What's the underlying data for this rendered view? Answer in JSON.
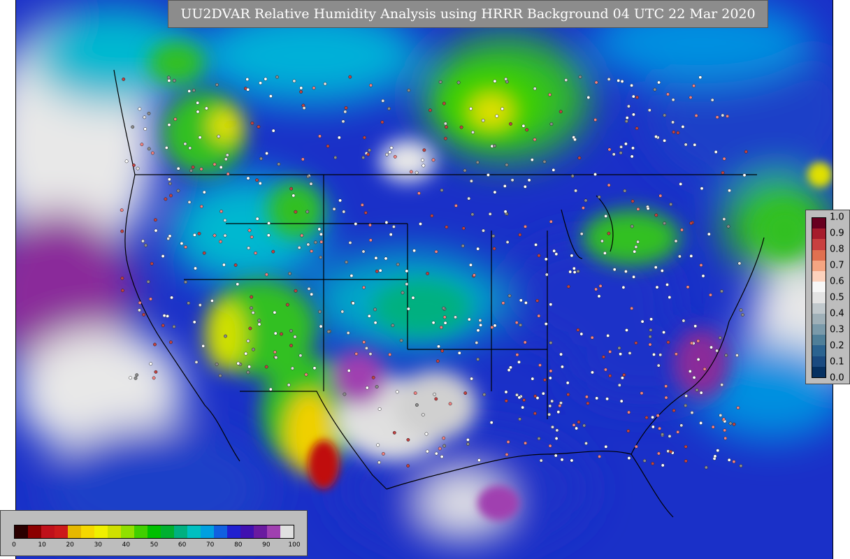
{
  "title": "UU2DVAR Relative Humidity Analysis using HRRR Background 04 UTC 22 Mar 2020",
  "map": {
    "region": "Continental United States",
    "field": "Relative Humidity",
    "overlays": [
      "coastlines",
      "state-borders",
      "country-borders",
      "observation-station-markers"
    ]
  },
  "rh_colorbar": {
    "ticks": [
      "0",
      "10",
      "20",
      "30",
      "40",
      "50",
      "60",
      "70",
      "80",
      "90",
      "100"
    ],
    "colors": [
      "#2a0000",
      "#8b0000",
      "#c0101a",
      "#cc1a1a",
      "#e6b800",
      "#f5d800",
      "#f0f000",
      "#cfe000",
      "#90e000",
      "#40d000",
      "#00c000",
      "#00b030",
      "#00b080",
      "#00c0c0",
      "#00a0e0",
      "#1060e0",
      "#2020d0",
      "#4010b0",
      "#6a1aa0",
      "#a040b0",
      "#e0e0e0"
    ]
  },
  "increment_colorbar": {
    "ticks": [
      "1.0",
      "0.9",
      "0.8",
      "0.7",
      "0.6",
      "0.5",
      "0.4",
      "0.3",
      "0.2",
      "0.1",
      "0.0"
    ],
    "colors": [
      "#67001f",
      "#a61c2c",
      "#c94040",
      "#e07050",
      "#f4a582",
      "#fcd2bd",
      "#f7f7f7",
      "#e3e3e3",
      "#c0c8cc",
      "#9fb0b8",
      "#7a9aaa",
      "#4f7f99",
      "#2b6390",
      "#1a4a80",
      "#053061"
    ]
  }
}
